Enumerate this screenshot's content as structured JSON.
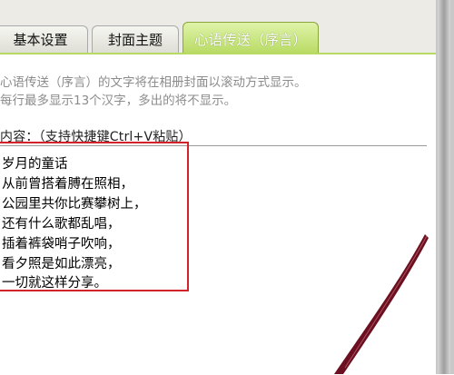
{
  "tabs": [
    {
      "label": "基本设置",
      "active": false
    },
    {
      "label": "封面主题",
      "active": false
    },
    {
      "label": "心语传送（序言）",
      "active": true
    }
  ],
  "description": [
    "心语传送（序言）的文字将在相册封面以滚动方式显示。",
    "每行最多显示13个汉字，多出的将不显示。"
  ],
  "content_label": "内容：（支持快捷键Ctrl+V粘贴）",
  "textarea_lines": [
    "岁月的童话",
    "从前曾搭着膊在照相，",
    "公园里共你比赛攀树上，",
    "还有什么歌都乱唱，",
    "插着裤袋哨子吹响，",
    "看夕照是如此漂亮，",
    "一切就这样分享。"
  ],
  "colors": {
    "active_tab": "#b7da62",
    "highlight_box": "#d2232a",
    "description_text": "#8c8c8c"
  }
}
